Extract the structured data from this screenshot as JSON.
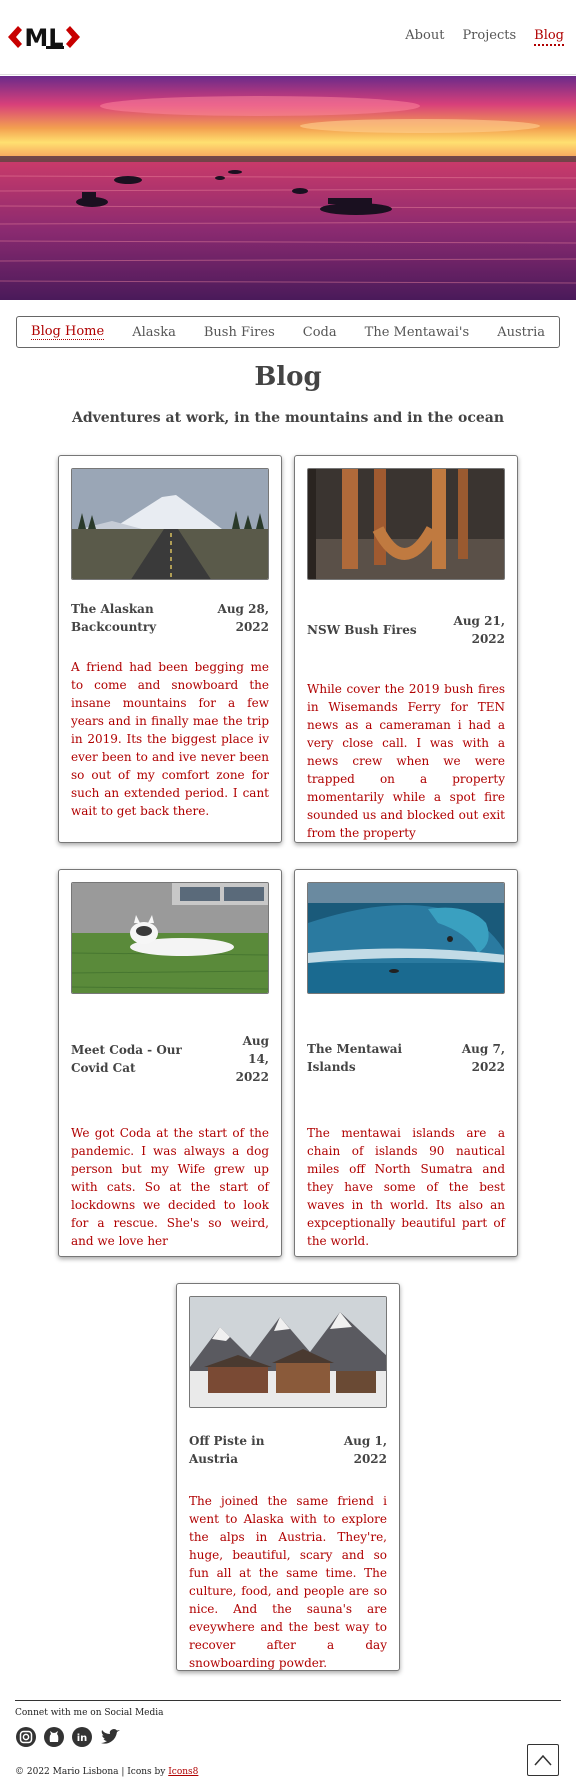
{
  "header": {
    "logo_text": "ML",
    "nav": [
      "About",
      "Projects",
      "Blog"
    ]
  },
  "subnav": [
    "Blog Home",
    "Alaska",
    "Bush Fires",
    "Coda",
    "The Mentawai's",
    "Austria"
  ],
  "page": {
    "title": "Blog",
    "subtitle": "Adventures at work, in the mountains and in the ocean"
  },
  "posts": [
    {
      "title": "The Alaskan Backcountry",
      "date": "Aug 28, 2022",
      "body": "A friend had been begging me to come and snowboard the insane mountains for a few years and in finally mae the trip in 2019. Its the biggest place iv ever been to and ive never been so out of my comfort zone for such an extended period. I cant wait to get back there."
    },
    {
      "title": "NSW Bush Fires",
      "date": "Aug 21, 2022",
      "body": "While cover the 2019 bush fires in Wisemands Ferry for TEN news as a cameraman i had a very close call. I was with a news crew when we were trapped on a property momentarily while a spot fire sounded us and blocked out exit from the property"
    },
    {
      "title": "Meet Coda - Our Covid Cat",
      "date": "Aug 14, 2022",
      "body": "We got Coda at the start of the pandemic. I was always a dog person but my Wife grew up with cats. So at the start of lockdowns we decided to look for a rescue. She's so weird, and we love her"
    },
    {
      "title": "The Mentawai Islands",
      "date": "Aug 7, 2022",
      "body": "The mentawai islands are a chain of islands 90 nautical miles off North Sumatra and they have some of the best waves in th world. Its also an expceptionally beautiful part of the world."
    },
    {
      "title": "Off Piste in Austria",
      "date": "Aug 1, 2022",
      "body": "The joined the same friend i went to Alaska with to explore the alps in Austria. They're, huge, beautiful, scary and so fun all at the same time. The culture, food, and people are so nice. And the sauna's are eveywhere and the best way to recover after a day snowboarding powder."
    }
  ],
  "footer": {
    "connect": "Connet with me on Social Media",
    "socials": [
      "instagram-icon",
      "github-icon",
      "linkedin-icon",
      "twitter-icon"
    ],
    "copyright": "© 2022 Mario Lisbona | Icons by ",
    "icons_link": "Icons8"
  },
  "colors": {
    "accent": "#b00000",
    "text": "#444444"
  }
}
